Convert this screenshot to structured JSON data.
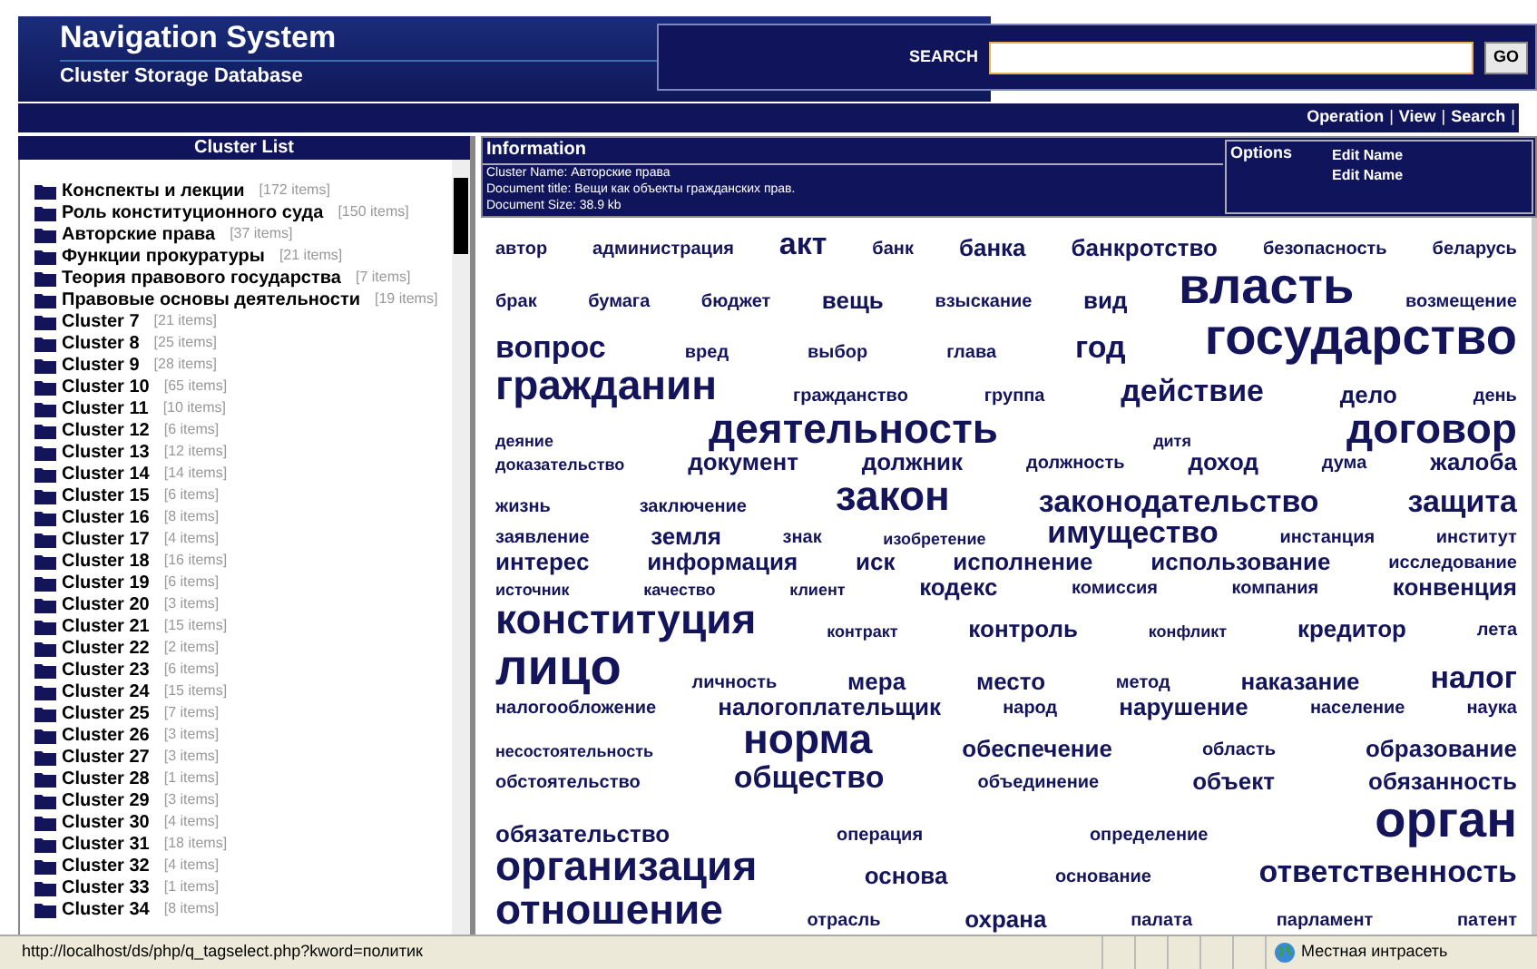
{
  "header": {
    "title": "Navigation System",
    "subtitle": "Cluster Storage Database"
  },
  "search": {
    "label": "SEARCH",
    "button": "GO"
  },
  "menu": {
    "separator": "|",
    "items": [
      {
        "label": "Operation"
      },
      {
        "label": "View"
      },
      {
        "label": "Search"
      }
    ]
  },
  "cluster_list": {
    "title": "Cluster List",
    "items": [
      {
        "name": "Конспекты и лекции",
        "count": "[172 items]"
      },
      {
        "name": "Роль конституционного суда",
        "count": "[150 items]"
      },
      {
        "name": "Авторские права",
        "count": "[37 items]"
      },
      {
        "name": "Функции прокуратуры",
        "count": "[21 items]"
      },
      {
        "name": "Теория правового государства",
        "count": "[7 items]"
      },
      {
        "name": "Правовые основы деятельности",
        "count": "[19 items]"
      },
      {
        "name": "Cluster 7",
        "count": "[21 items]"
      },
      {
        "name": "Cluster 8",
        "count": "[25 items]"
      },
      {
        "name": "Cluster 9",
        "count": "[28 items]"
      },
      {
        "name": "Cluster 10",
        "count": "[65 items]"
      },
      {
        "name": "Cluster 11",
        "count": "[10 items]"
      },
      {
        "name": "Cluster 12",
        "count": "[6 items]"
      },
      {
        "name": "Cluster 13",
        "count": "[12 items]"
      },
      {
        "name": "Cluster 14",
        "count": "[14 items]"
      },
      {
        "name": "Cluster 15",
        "count": "[6 items]"
      },
      {
        "name": "Cluster 16",
        "count": "[8 items]"
      },
      {
        "name": "Cluster 17",
        "count": "[4 items]"
      },
      {
        "name": "Cluster 18",
        "count": "[16 items]"
      },
      {
        "name": "Cluster 19",
        "count": "[6 items]"
      },
      {
        "name": "Cluster 20",
        "count": "[3 items]"
      },
      {
        "name": "Cluster 21",
        "count": "[15 items]"
      },
      {
        "name": "Cluster 22",
        "count": "[2 items]"
      },
      {
        "name": "Cluster 23",
        "count": "[6 items]"
      },
      {
        "name": "Cluster 24",
        "count": "[15 items]"
      },
      {
        "name": "Cluster 25",
        "count": "[7 items]"
      },
      {
        "name": "Cluster 26",
        "count": "[3 items]"
      },
      {
        "name": "Cluster 27",
        "count": "[3 items]"
      },
      {
        "name": "Cluster 28",
        "count": "[1 items]"
      },
      {
        "name": "Cluster 29",
        "count": "[3 items]"
      },
      {
        "name": "Cluster 30",
        "count": "[4 items]"
      },
      {
        "name": "Cluster 31",
        "count": "[18 items]"
      },
      {
        "name": "Cluster 32",
        "count": "[4 items]"
      },
      {
        "name": "Cluster 33",
        "count": "[1 items]"
      },
      {
        "name": "Cluster 34",
        "count": "[8 items]"
      }
    ]
  },
  "information": {
    "title": "Information",
    "lines": [
      "Cluster Name: Авторские права",
      "Document title: Вещи как объекты гражданских прав.",
      "Document Size: 38.9 kb"
    ]
  },
  "options": {
    "title": "Options",
    "links": [
      "Edit Name",
      "Edit Name"
    ]
  },
  "tag_cloud": [
    [
      {
        "word": "автор",
        "kind": "s"
      },
      {
        "word": "администрация",
        "kind": "s"
      },
      {
        "word": "акт",
        "kind": "l"
      },
      {
        "word": "банк",
        "kind": "s"
      },
      {
        "word": "банка",
        "kind": "m"
      },
      {
        "word": "банкротство",
        "kind": "m"
      },
      {
        "word": "безопасность",
        "kind": "s"
      },
      {
        "word": "беларусь",
        "kind": "s"
      }
    ],
    [
      {
        "word": "брак",
        "kind": "s"
      },
      {
        "word": "бумага",
        "kind": "s"
      },
      {
        "word": "бюджет",
        "kind": "s"
      },
      {
        "word": "вещь",
        "kind": "m"
      },
      {
        "word": "взыскание",
        "kind": "s"
      },
      {
        "word": "вид",
        "kind": "m"
      },
      {
        "word": "власть",
        "kind": "xxl"
      },
      {
        "word": "возмещение",
        "kind": "s"
      }
    ],
    [
      {
        "word": "вопрос",
        "kind": "l"
      },
      {
        "word": "вред",
        "kind": "s"
      },
      {
        "word": "выбор",
        "kind": "s"
      },
      {
        "word": "глава",
        "kind": "s"
      },
      {
        "word": "год",
        "kind": "l"
      },
      {
        "word": "государство",
        "kind": "xxl"
      }
    ],
    [
      {
        "word": "гражданин",
        "kind": "xl"
      },
      {
        "word": "гражданство",
        "kind": "s"
      },
      {
        "word": "группа",
        "kind": "s"
      },
      {
        "word": "действие",
        "kind": "l"
      },
      {
        "word": "дело",
        "kind": "m"
      },
      {
        "word": "день",
        "kind": "s"
      }
    ],
    [
      {
        "word": "деяние",
        "kind": "xs"
      },
      {
        "word": "деятельность",
        "kind": "xl"
      },
      {
        "word": "дитя",
        "kind": "xs"
      },
      {
        "word": "договор",
        "kind": "xl"
      }
    ],
    [
      {
        "word": "доказательство",
        "kind": "xs"
      },
      {
        "word": "документ",
        "kind": "m"
      },
      {
        "word": "должник",
        "kind": "m"
      },
      {
        "word": "должность",
        "kind": "s"
      },
      {
        "word": "доход",
        "kind": "m"
      },
      {
        "word": "дума",
        "kind": "s"
      },
      {
        "word": "жалоба",
        "kind": "m"
      }
    ],
    [
      {
        "word": "жизнь",
        "kind": "s"
      },
      {
        "word": "заключение",
        "kind": "s"
      },
      {
        "word": "закон",
        "kind": "xl"
      },
      {
        "word": "законодательство",
        "kind": "l"
      },
      {
        "word": "защита",
        "kind": "l"
      }
    ],
    [
      {
        "word": "заявление",
        "kind": "s"
      },
      {
        "word": "земля",
        "kind": "m"
      },
      {
        "word": "знак",
        "kind": "s"
      },
      {
        "word": "изобретение",
        "kind": "xs"
      },
      {
        "word": "имущество",
        "kind": "l"
      },
      {
        "word": "инстанция",
        "kind": "s"
      },
      {
        "word": "институт",
        "kind": "s"
      }
    ],
    [
      {
        "word": "интерес",
        "kind": "m"
      },
      {
        "word": "информация",
        "kind": "m"
      },
      {
        "word": "иск",
        "kind": "m"
      },
      {
        "word": "исполнение",
        "kind": "m"
      },
      {
        "word": "использование",
        "kind": "m"
      },
      {
        "word": "исследование",
        "kind": "s"
      }
    ],
    [
      {
        "word": "источник",
        "kind": "xs"
      },
      {
        "word": "качество",
        "kind": "xs"
      },
      {
        "word": "клиент",
        "kind": "xs"
      },
      {
        "word": "кодекс",
        "kind": "m"
      },
      {
        "word": "комиссия",
        "kind": "s"
      },
      {
        "word": "компания",
        "kind": "s"
      },
      {
        "word": "конвенция",
        "kind": "m"
      }
    ],
    [
      {
        "word": "конституция",
        "kind": "xl"
      },
      {
        "word": "контракт",
        "kind": "xs"
      },
      {
        "word": "контроль",
        "kind": "m"
      },
      {
        "word": "конфликт",
        "kind": "xs"
      },
      {
        "word": "кредитор",
        "kind": "m"
      },
      {
        "word": "лета",
        "kind": "s"
      }
    ],
    [
      {
        "word": "лицо",
        "kind": "xxl"
      },
      {
        "word": "личность",
        "kind": "s"
      },
      {
        "word": "мера",
        "kind": "m"
      },
      {
        "word": "место",
        "kind": "m"
      },
      {
        "word": "метод",
        "kind": "s"
      },
      {
        "word": "наказание",
        "kind": "m"
      },
      {
        "word": "налог",
        "kind": "l"
      }
    ],
    [
      {
        "word": "налогообложение",
        "kind": "s"
      },
      {
        "word": "налогоплательщик",
        "kind": "m"
      },
      {
        "word": "народ",
        "kind": "s"
      },
      {
        "word": "нарушение",
        "kind": "m"
      },
      {
        "word": "население",
        "kind": "s"
      },
      {
        "word": "наука",
        "kind": "s"
      }
    ],
    [
      {
        "word": "несостоятельность",
        "kind": "xs"
      },
      {
        "word": "норма",
        "kind": "xl"
      },
      {
        "word": "обеспечение",
        "kind": "m"
      },
      {
        "word": "область",
        "kind": "s"
      },
      {
        "word": "образование",
        "kind": "m"
      }
    ],
    [
      {
        "word": "обстоятельство",
        "kind": "s"
      },
      {
        "word": "общество",
        "kind": "l"
      },
      {
        "word": "объединение",
        "kind": "s"
      },
      {
        "word": "объект",
        "kind": "m"
      },
      {
        "word": "обязанность",
        "kind": "m"
      }
    ],
    [
      {
        "word": "обязательство",
        "kind": "m"
      },
      {
        "word": "операция",
        "kind": "s"
      },
      {
        "word": "определение",
        "kind": "s"
      },
      {
        "word": "орган",
        "kind": "xxl"
      }
    ],
    [
      {
        "word": "организация",
        "kind": "xl"
      },
      {
        "word": "основа",
        "kind": "m"
      },
      {
        "word": "основание",
        "kind": "s"
      },
      {
        "word": "ответственность",
        "kind": "l"
      }
    ],
    [
      {
        "word": "отношение",
        "kind": "xl"
      },
      {
        "word": "отрасль",
        "kind": "s"
      },
      {
        "word": "охрана",
        "kind": "m"
      },
      {
        "word": "палата",
        "kind": "s"
      },
      {
        "word": "парламент",
        "kind": "s"
      },
      {
        "word": "патент",
        "kind": "s"
      }
    ]
  ],
  "status_bar": {
    "url": "http://localhost/ds/php/q_tagselect.php?kword=политик",
    "zone": "Местная интрасеть"
  }
}
